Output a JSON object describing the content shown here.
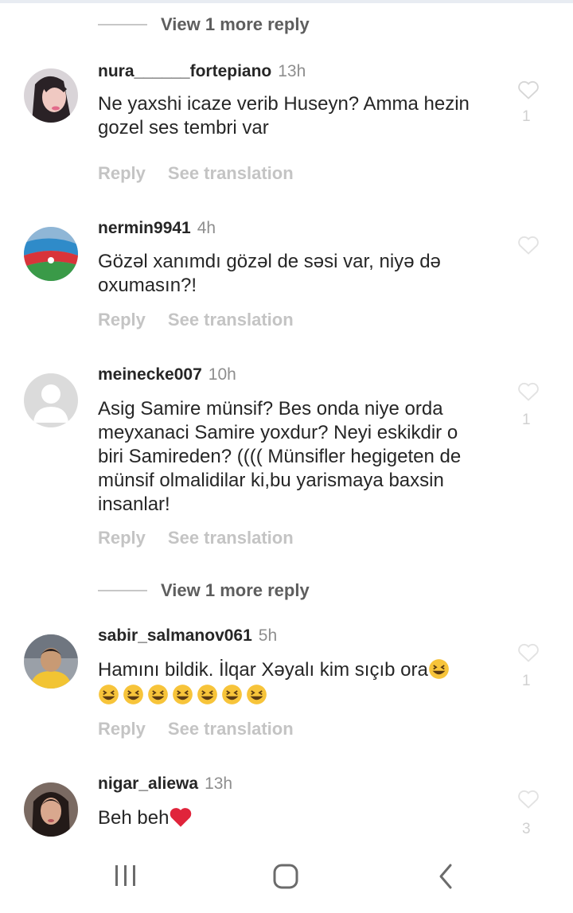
{
  "more_replies_label": "View 1 more reply",
  "actions": {
    "reply": "Reply",
    "translate": "See translation"
  },
  "comments": [
    {
      "username": "nura______fortepiano",
      "time": "13h",
      "text_lines": [
        "Ne yaxshi icaze verib Huseyn? Amma hezin",
        "gozel ses tembri var"
      ],
      "like_count": "1"
    },
    {
      "username": "nermin9941",
      "time": "4h",
      "text_lines": [
        "Gözəl xanımdı gözəl de səsi var, niyə də",
        "oxumasın?!"
      ],
      "like_count": ""
    },
    {
      "username": "meinecke007",
      "time": "10h",
      "text_lines": [
        "Asig Samire münsif? Bes onda niye orda",
        "meyxanaci Samire yoxdur? Neyi eskikdir o",
        "biri Samireden? (((( Münsifler hegigeten de",
        "münsif olmalidilar ki,bu yarismaya baxsin",
        "insanlar!"
      ],
      "like_count": "1"
    },
    {
      "username": "sabir_salmanov061",
      "time": "5h",
      "text_lines": [
        "Hamını bildik. İlqar Xəyalı kim sıçıb ora"
      ],
      "like_count": "1"
    },
    {
      "username": "nigar_aliewa",
      "time": "13h",
      "text_lines": [
        "Beh beh"
      ],
      "like_count": "3"
    }
  ],
  "icons": {
    "like": "heart-outline-icon",
    "emoji": "grinning-squinting-face-icon",
    "heart": "red-heart-icon",
    "nav_recent": "recent-apps-icon",
    "nav_home": "home-icon",
    "nav_back": "back-icon"
  },
  "colors": {
    "text": "#262626",
    "muted": "#8e8e8e",
    "action": "#c4c4c4",
    "heart": "#e0243b",
    "emoji": "#f7c43a"
  }
}
